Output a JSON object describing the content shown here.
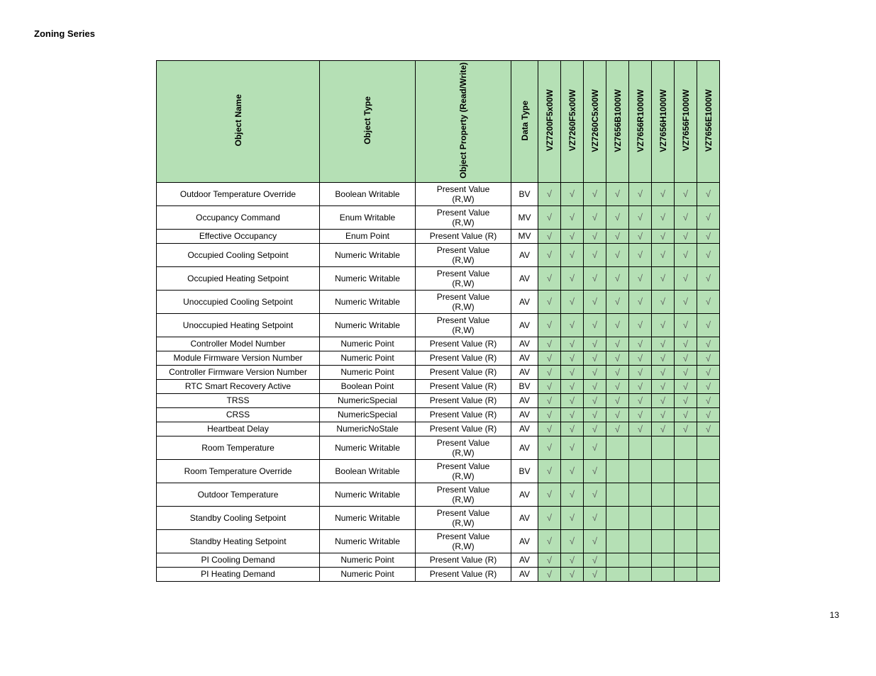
{
  "page": {
    "title": "Zoning Series",
    "number": "13"
  },
  "headers": {
    "name": "Object Name",
    "type": "Object Type",
    "prop": "Object Property (Read/Write)",
    "dtype": "Data Type",
    "products": [
      "VZ7200F5x00W",
      "VZ7260F5x00W",
      "VZ7260C5x00W",
      "VZ7656B1000W",
      "VZ7656R1000W",
      "VZ7656H1000W",
      "VZ7656F1000W",
      "VZ7656E1000W"
    ]
  },
  "check": "√",
  "rows": [
    {
      "name": "Outdoor Temperature Override",
      "type": "Boolean Writable",
      "prop": "Present Value (R,W)",
      "dtype": "BV",
      "mask": [
        1,
        1,
        1,
        1,
        1,
        1,
        1,
        1
      ]
    },
    {
      "name": "Occupancy Command",
      "type": "Enum Writable",
      "prop": "Present Value (R,W)",
      "dtype": "MV",
      "mask": [
        1,
        1,
        1,
        1,
        1,
        1,
        1,
        1
      ]
    },
    {
      "name": "Effective Occupancy",
      "type": "Enum Point",
      "prop": "Present Value (R)",
      "dtype": "MV",
      "mask": [
        1,
        1,
        1,
        1,
        1,
        1,
        1,
        1
      ]
    },
    {
      "name": "Occupied Cooling Setpoint",
      "type": "Numeric Writable",
      "prop": "Present Value (R,W)",
      "dtype": "AV",
      "mask": [
        1,
        1,
        1,
        1,
        1,
        1,
        1,
        1
      ]
    },
    {
      "name": "Occupied Heating Setpoint",
      "type": "Numeric Writable",
      "prop": "Present Value (R,W)",
      "dtype": "AV",
      "mask": [
        1,
        1,
        1,
        1,
        1,
        1,
        1,
        1
      ]
    },
    {
      "name": "Unoccupied Cooling Setpoint",
      "type": "Numeric Writable",
      "prop": "Present Value (R,W)",
      "dtype": "AV",
      "mask": [
        1,
        1,
        1,
        1,
        1,
        1,
        1,
        1
      ]
    },
    {
      "name": "Unoccupied Heating Setpoint",
      "type": "Numeric Writable",
      "prop": "Present Value (R,W)",
      "dtype": "AV",
      "mask": [
        1,
        1,
        1,
        1,
        1,
        1,
        1,
        1
      ]
    },
    {
      "name": "Controller Model Number",
      "type": "Numeric Point",
      "prop": "Present Value (R)",
      "dtype": "AV",
      "mask": [
        1,
        1,
        1,
        1,
        1,
        1,
        1,
        1
      ]
    },
    {
      "name": "Module Firmware Version Number",
      "type": "Numeric Point",
      "prop": "Present Value (R)",
      "dtype": "AV",
      "mask": [
        1,
        1,
        1,
        1,
        1,
        1,
        1,
        1
      ]
    },
    {
      "name": "Controller Firmware Version Number",
      "type": "Numeric Point",
      "prop": "Present Value (R)",
      "dtype": "AV",
      "mask": [
        1,
        1,
        1,
        1,
        1,
        1,
        1,
        1
      ]
    },
    {
      "name": "RTC Smart Recovery Active",
      "type": "Boolean Point",
      "prop": "Present Value (R)",
      "dtype": "BV",
      "mask": [
        1,
        1,
        1,
        1,
        1,
        1,
        1,
        1
      ]
    },
    {
      "name": "TRSS",
      "type": "NumericSpecial",
      "prop": "Present Value (R)",
      "dtype": "AV",
      "mask": [
        1,
        1,
        1,
        1,
        1,
        1,
        1,
        1
      ]
    },
    {
      "name": "CRSS",
      "type": "NumericSpecial",
      "prop": "Present Value (R)",
      "dtype": "AV",
      "mask": [
        1,
        1,
        1,
        1,
        1,
        1,
        1,
        1
      ]
    },
    {
      "name": "Heartbeat Delay",
      "type": "NumericNoStale",
      "prop": "Present Value (R)",
      "dtype": "AV",
      "mask": [
        1,
        1,
        1,
        1,
        1,
        1,
        1,
        1
      ]
    },
    {
      "name": "Room Temperature",
      "type": "Numeric Writable",
      "prop": "Present Value (R,W)",
      "dtype": "AV",
      "mask": [
        1,
        1,
        1,
        0,
        0,
        0,
        0,
        0
      ]
    },
    {
      "name": "Room Temperature Override",
      "type": "Boolean Writable",
      "prop": "Present Value (R,W)",
      "dtype": "BV",
      "mask": [
        1,
        1,
        1,
        0,
        0,
        0,
        0,
        0
      ]
    },
    {
      "name": "Outdoor Temperature",
      "type": "Numeric Writable",
      "prop": "Present Value (R,W)",
      "dtype": "AV",
      "mask": [
        1,
        1,
        1,
        0,
        0,
        0,
        0,
        0
      ]
    },
    {
      "name": "Standby Cooling Setpoint",
      "type": "Numeric Writable",
      "prop": "Present Value (R,W)",
      "dtype": "AV",
      "mask": [
        1,
        1,
        1,
        0,
        0,
        0,
        0,
        0
      ]
    },
    {
      "name": "Standby Heating Setpoint",
      "type": "Numeric Writable",
      "prop": "Present Value (R,W)",
      "dtype": "AV",
      "mask": [
        1,
        1,
        1,
        0,
        0,
        0,
        0,
        0
      ]
    },
    {
      "name": "PI Cooling Demand",
      "type": "Numeric Point",
      "prop": "Present Value (R)",
      "dtype": "AV",
      "mask": [
        1,
        1,
        1,
        0,
        0,
        0,
        0,
        0
      ]
    },
    {
      "name": "PI Heating Demand",
      "type": "Numeric Point",
      "prop": "Present Value (R)",
      "dtype": "AV",
      "mask": [
        1,
        1,
        1,
        0,
        0,
        0,
        0,
        0
      ]
    }
  ]
}
